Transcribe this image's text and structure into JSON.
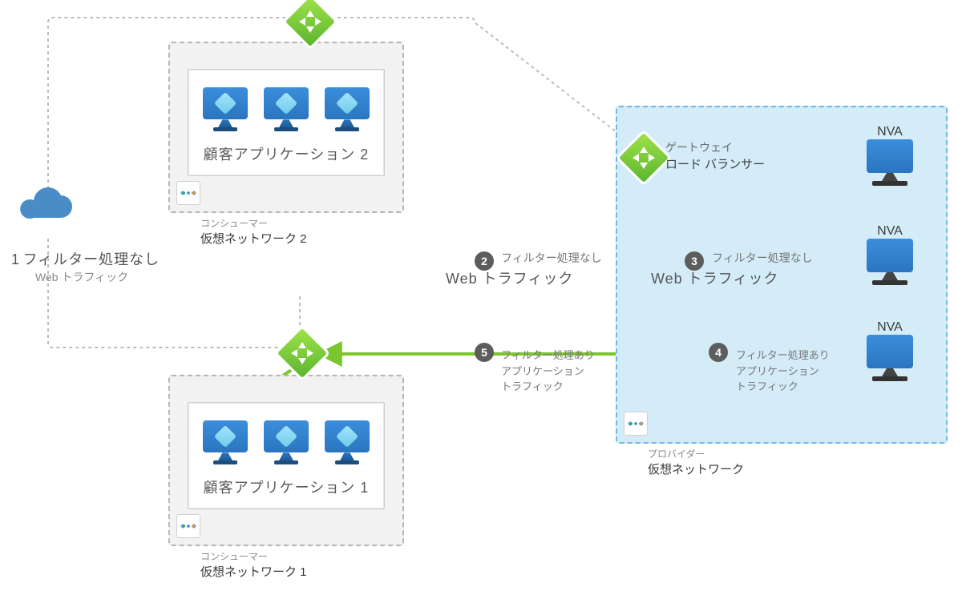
{
  "step1": {
    "num": "1",
    "line1": "フィルター処理なし",
    "line2": "Web トラフィック"
  },
  "step2": {
    "num": "2",
    "line1": "フィルター処理なし",
    "line2": "Web トラフィック"
  },
  "step3": {
    "num": "3",
    "line1": "フィルター処理なし",
    "line2": "Web トラフィック"
  },
  "step4": {
    "num": "4",
    "line1": "フィルター処理あり",
    "line2": "アプリケーション",
    "line3": "トラフィック"
  },
  "step5": {
    "num": "5",
    "line1": "フィルター処理あり",
    "line2": "アプリケーション",
    "line3": "トラフィック"
  },
  "consumer2": {
    "app_title": "顧客アプリケーション 2",
    "sub1": "コンシューマー",
    "sub2": "仮想ネットワーク 2"
  },
  "consumer1": {
    "app_title": "顧客アプリケーション 1",
    "sub1": "コンシューマー",
    "sub2": "仮想ネットワーク 1"
  },
  "provider": {
    "sub1": "プロバイダー",
    "sub2": "仮想ネットワーク"
  },
  "gateway_lb": {
    "line1": "ゲートウェイ",
    "line2": "ロード バランサー"
  },
  "nva": {
    "label": "NVA"
  }
}
